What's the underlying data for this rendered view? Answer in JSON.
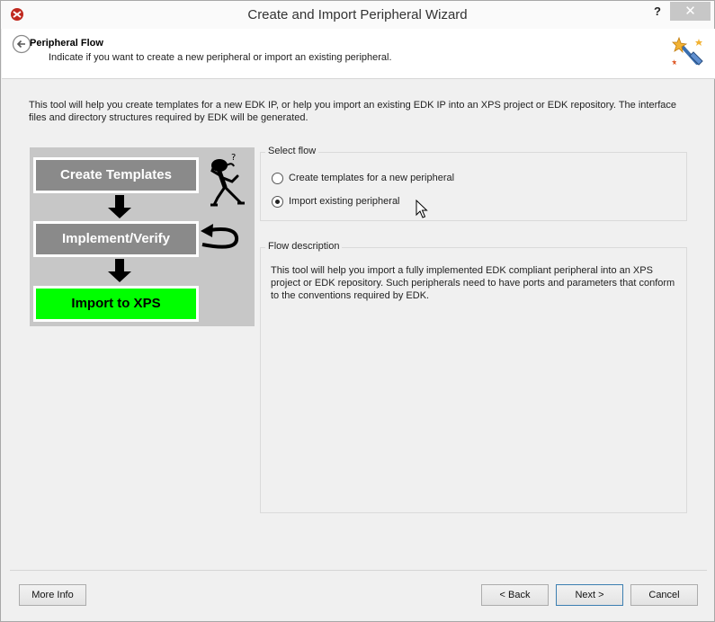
{
  "window": {
    "title": "Create and Import Peripheral Wizard",
    "help_label": "?",
    "close_label": "✕"
  },
  "header": {
    "title": "Peripheral Flow",
    "subtitle": "Indicate if you want to create a new peripheral or import an existing peripheral."
  },
  "intro": "This tool will help you create templates for a new EDK IP, or help you import an existing EDK IP into an XPS project or EDK repository. The interface files and directory structures required by EDK will be generated.",
  "flow_diagram": {
    "steps": [
      "Create Templates",
      "Implement/Verify",
      "Import to XPS"
    ],
    "highlight_color": "#00ff00",
    "box_color": "#8a8a8a",
    "panel_color": "#c7c7c7"
  },
  "select_flow": {
    "label": "Select flow",
    "options": [
      {
        "label": "Create templates for a new peripheral",
        "checked": false
      },
      {
        "label": "Import existing peripheral",
        "checked": true
      }
    ]
  },
  "flow_description": {
    "label": "Flow description",
    "text": "This tool will help you import a fully implemented EDK compliant peripheral into an XPS project or EDK repository. Such peripherals need to have ports and parameters that conform to the conventions required by EDK."
  },
  "buttons": {
    "more_info": "More Info",
    "back": "< Back",
    "next": "Next >",
    "cancel": "Cancel"
  },
  "icons": {
    "app": "xilinx-logo-icon",
    "back": "back-arrow-icon",
    "wizard": "wizard-wand-icon",
    "cursor": "mouse-cursor-icon"
  }
}
